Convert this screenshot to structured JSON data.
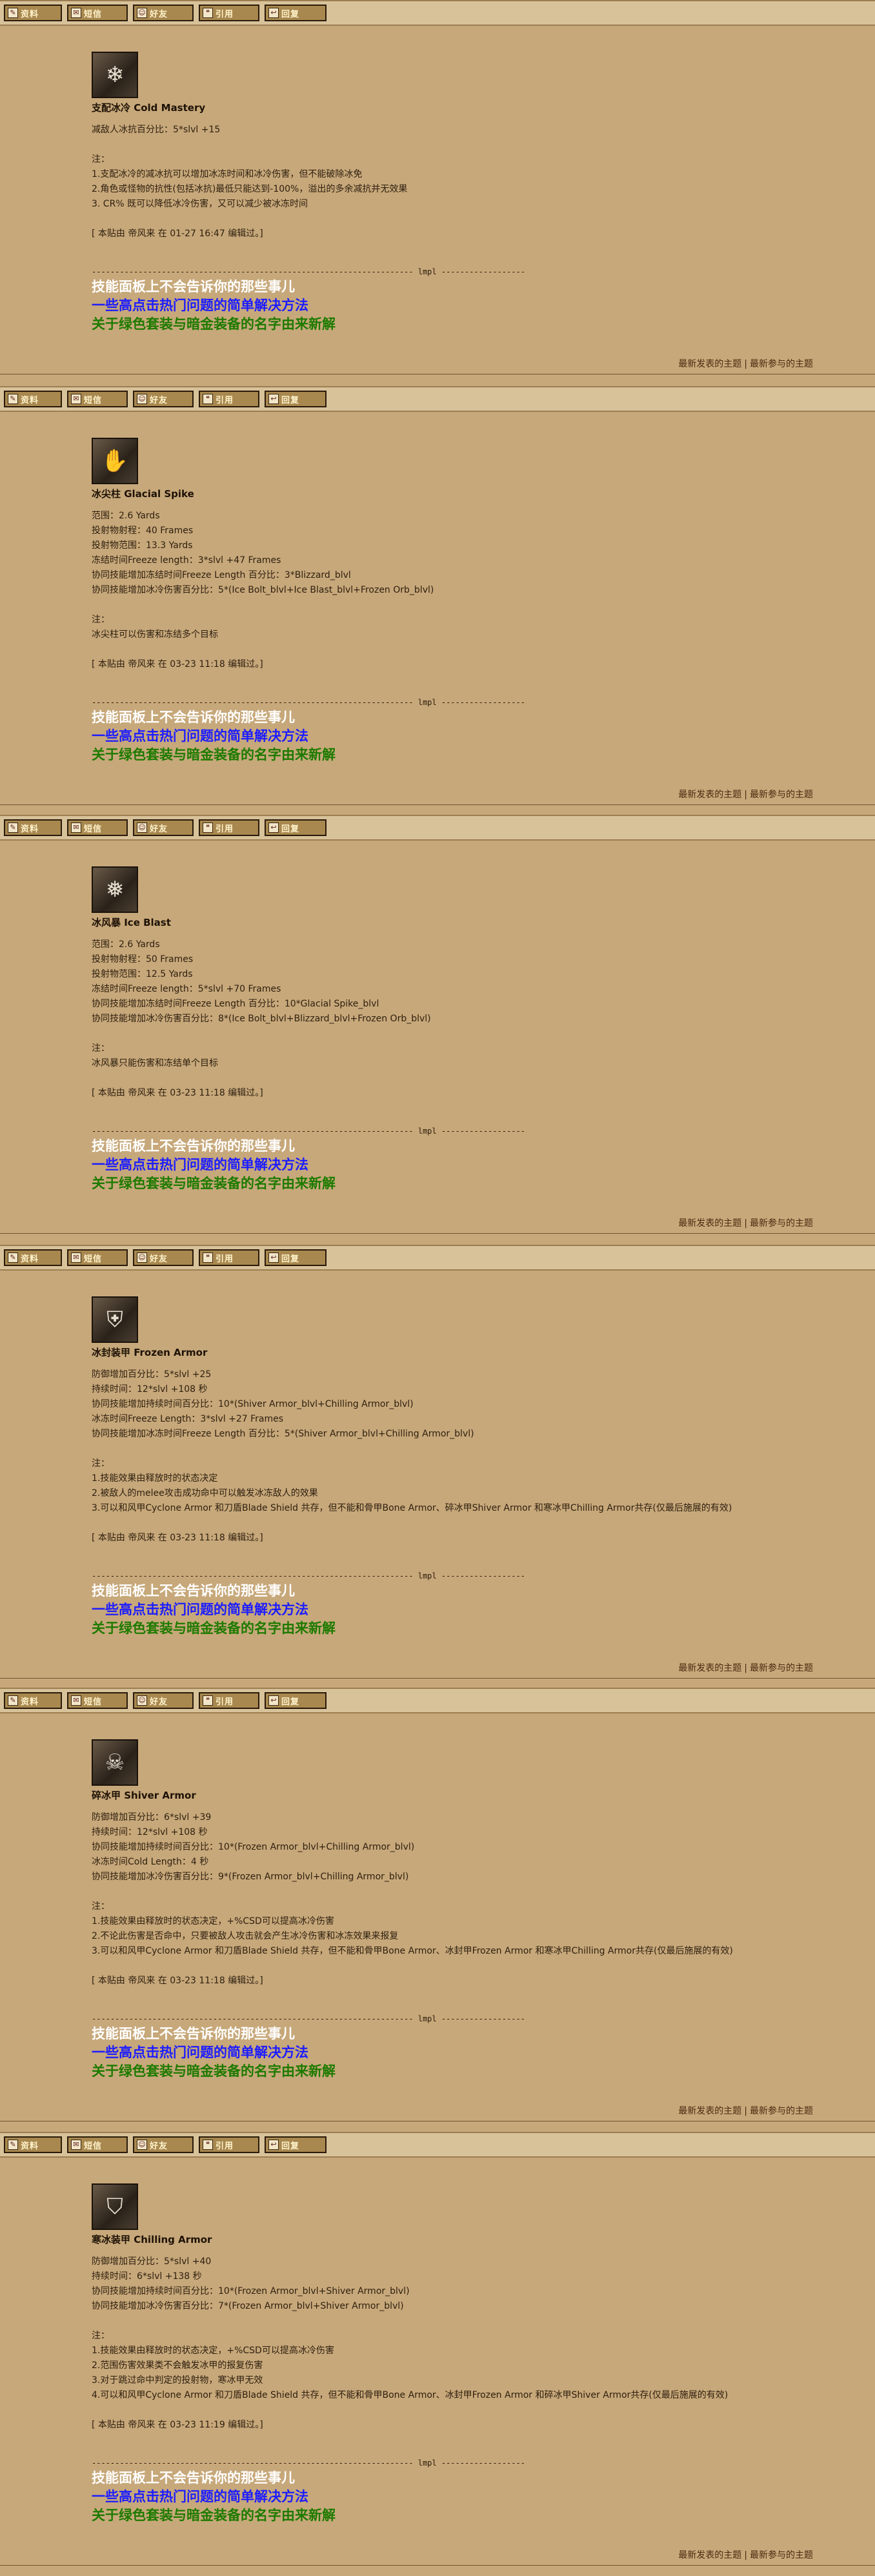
{
  "toolbar": {
    "buttons": [
      {
        "icon": "quote-icon",
        "glyph": "✎",
        "label": "资料"
      },
      {
        "icon": "message-icon",
        "glyph": "✉",
        "label": "短信"
      },
      {
        "icon": "friend-icon",
        "glyph": "☺",
        "label": "好友"
      },
      {
        "icon": "reference-icon",
        "glyph": "❝",
        "label": "引用"
      },
      {
        "icon": "reply-icon",
        "glyph": "↩",
        "label": "回复"
      }
    ]
  },
  "signature": {
    "divider": "--------------------------------------------------------------------- lmpl ------------------",
    "line1": "技能面板上不会告诉你的那些事儿",
    "line2": "一些高点击热门问题的简单解决方法",
    "line3": "关于绿色套装与暗金装备的名字由来新解"
  },
  "footer": {
    "latest_topics": "最新发表的主题",
    "separator": "|",
    "latest_replies": "最新参与的主题"
  },
  "posts": [
    {
      "title": "支配冰冷 Cold Mastery",
      "icon": "cold-mastery-icon",
      "glyph": "❄",
      "lines": [
        "减敌人冰抗百分比：5*slvl +15",
        "",
        "注：",
        "1.支配冰冷的减冰抗可以增加冰冻时间和冰冷伤害，但不能破除冰免",
        "2.角色或怪物的抗性(包括冰抗)最低只能达到-100%，溢出的多余减抗并无效果",
        "3. CR% 既可以降低冰冷伤害，又可以减少被冰冻时间",
        "",
        "[ 本贴由 帝风来 在 01-27 16:47 编辑过。]"
      ]
    },
    {
      "title": "冰尖柱 Glacial Spike",
      "icon": "glacial-spike-icon",
      "glyph": "✋",
      "lines": [
        "范围：2.6 Yards",
        "投射物射程：40 Frames",
        "投射物范围：13.3 Yards",
        "冻结时间Freeze length：3*slvl +47 Frames",
        "协同技能增加冻结时间Freeze Length 百分比：3*Blizzard_blvl",
        "协同技能增加冰冷伤害百分比：5*(Ice Bolt_blvl+Ice Blast_blvl+Frozen Orb_blvl)",
        "",
        "注：",
        "冰尖柱可以伤害和冻结多个目标",
        "",
        "[ 本贴由 帝风来 在 03-23 11:18 编辑过。]"
      ]
    },
    {
      "title": "冰风暴 Ice Blast",
      "icon": "ice-blast-icon",
      "glyph": "❅",
      "lines": [
        "范围：2.6 Yards",
        "投射物射程：50 Frames",
        "投射物范围：12.5 Yards",
        "冻结时间Freeze length：5*slvl +70 Frames",
        "协同技能增加冻结时间Freeze Length 百分比：10*Glacial Spike_blvl",
        "协同技能增加冰冷伤害百分比：8*(Ice Bolt_blvl+Blizzard_blvl+Frozen Orb_blvl)",
        "",
        "注：",
        "冰风暴只能伤害和冻结单个目标",
        "",
        "[ 本贴由 帝风来 在 03-23 11:18 编辑过。]"
      ]
    },
    {
      "title": "冰封装甲 Frozen Armor",
      "icon": "frozen-armor-icon",
      "glyph": "⛨",
      "lines": [
        "防御增加百分比：5*slvl +25",
        "持续时间：12*slvl +108 秒",
        "协同技能增加持续时间百分比：10*(Shiver Armor_blvl+Chilling Armor_blvl)",
        "冰冻时间Freeze Length：3*slvl +27 Frames",
        "协同技能增加冰冻时间Freeze Length 百分比：5*(Shiver Armor_blvl+Chilling Armor_blvl)",
        "",
        "注：",
        "1.技能效果由释放时的状态决定",
        "2.被敌人的melee攻击成功命中可以触发冰冻敌人的效果",
        "3.可以和风甲Cyclone Armor 和刀盾Blade Shield 共存，但不能和骨甲Bone Armor、碎冰甲Shiver Armor 和寒冰甲Chilling Armor共存(仅最后施展的有效)",
        "",
        "[ 本贴由 帝风来 在 03-23 11:18 编辑过。]"
      ]
    },
    {
      "title": "碎冰甲 Shiver Armor",
      "icon": "shiver-armor-icon",
      "glyph": "☠",
      "lines": [
        "防御增加百分比：6*slvl +39",
        "持续时间：12*slvl +108 秒",
        "协同技能增加持续时间百分比：10*(Frozen Armor_blvl+Chilling Armor_blvl)",
        "冰冻时间Cold Length：4 秒",
        "协同技能增加冰冷伤害百分比：9*(Frozen Armor_blvl+Chilling Armor_blvl)",
        "",
        "注：",
        "1.技能效果由释放时的状态决定，+%CSD可以提高冰冷伤害",
        "2.不论此伤害是否命中，只要被敌人攻击就会产生冰冷伤害和冰冻效果来报复",
        "3.可以和风甲Cyclone Armor 和刀盾Blade Shield 共存，但不能和骨甲Bone Armor、冰封甲Frozen Armor 和寒冰甲Chilling Armor共存(仅最后施展的有效)",
        "",
        "[ 本贴由 帝风来 在 03-23 11:18 编辑过。]"
      ]
    },
    {
      "title": "寒冰装甲 Chilling Armor",
      "icon": "chilling-armor-icon",
      "glyph": "⛉",
      "lines": [
        "防御增加百分比：5*slvl +40",
        "持续时间：6*slvl +138 秒",
        "协同技能增加持续时间百分比：10*(Frozen Armor_blvl+Shiver Armor_blvl)",
        "协同技能增加冰冷伤害百分比：7*(Frozen Armor_blvl+Shiver Armor_blvl)",
        "",
        "注：",
        "1.技能效果由释放时的状态决定，+%CSD可以提高冰冷伤害",
        "2.范围伤害效果类不会触发冰甲的报复伤害",
        "3.对于跳过命中判定的投射物，寒冰甲无效",
        "4.可以和风甲Cyclone Armor 和刀盾Blade Shield 共存，但不能和骨甲Bone Armor、冰封甲Frozen Armor 和碎冰甲Shiver Armor共存(仅最后施展的有效)",
        "",
        "[ 本贴由 帝风来 在 03-23 11:19 编辑过。]"
      ]
    }
  ]
}
